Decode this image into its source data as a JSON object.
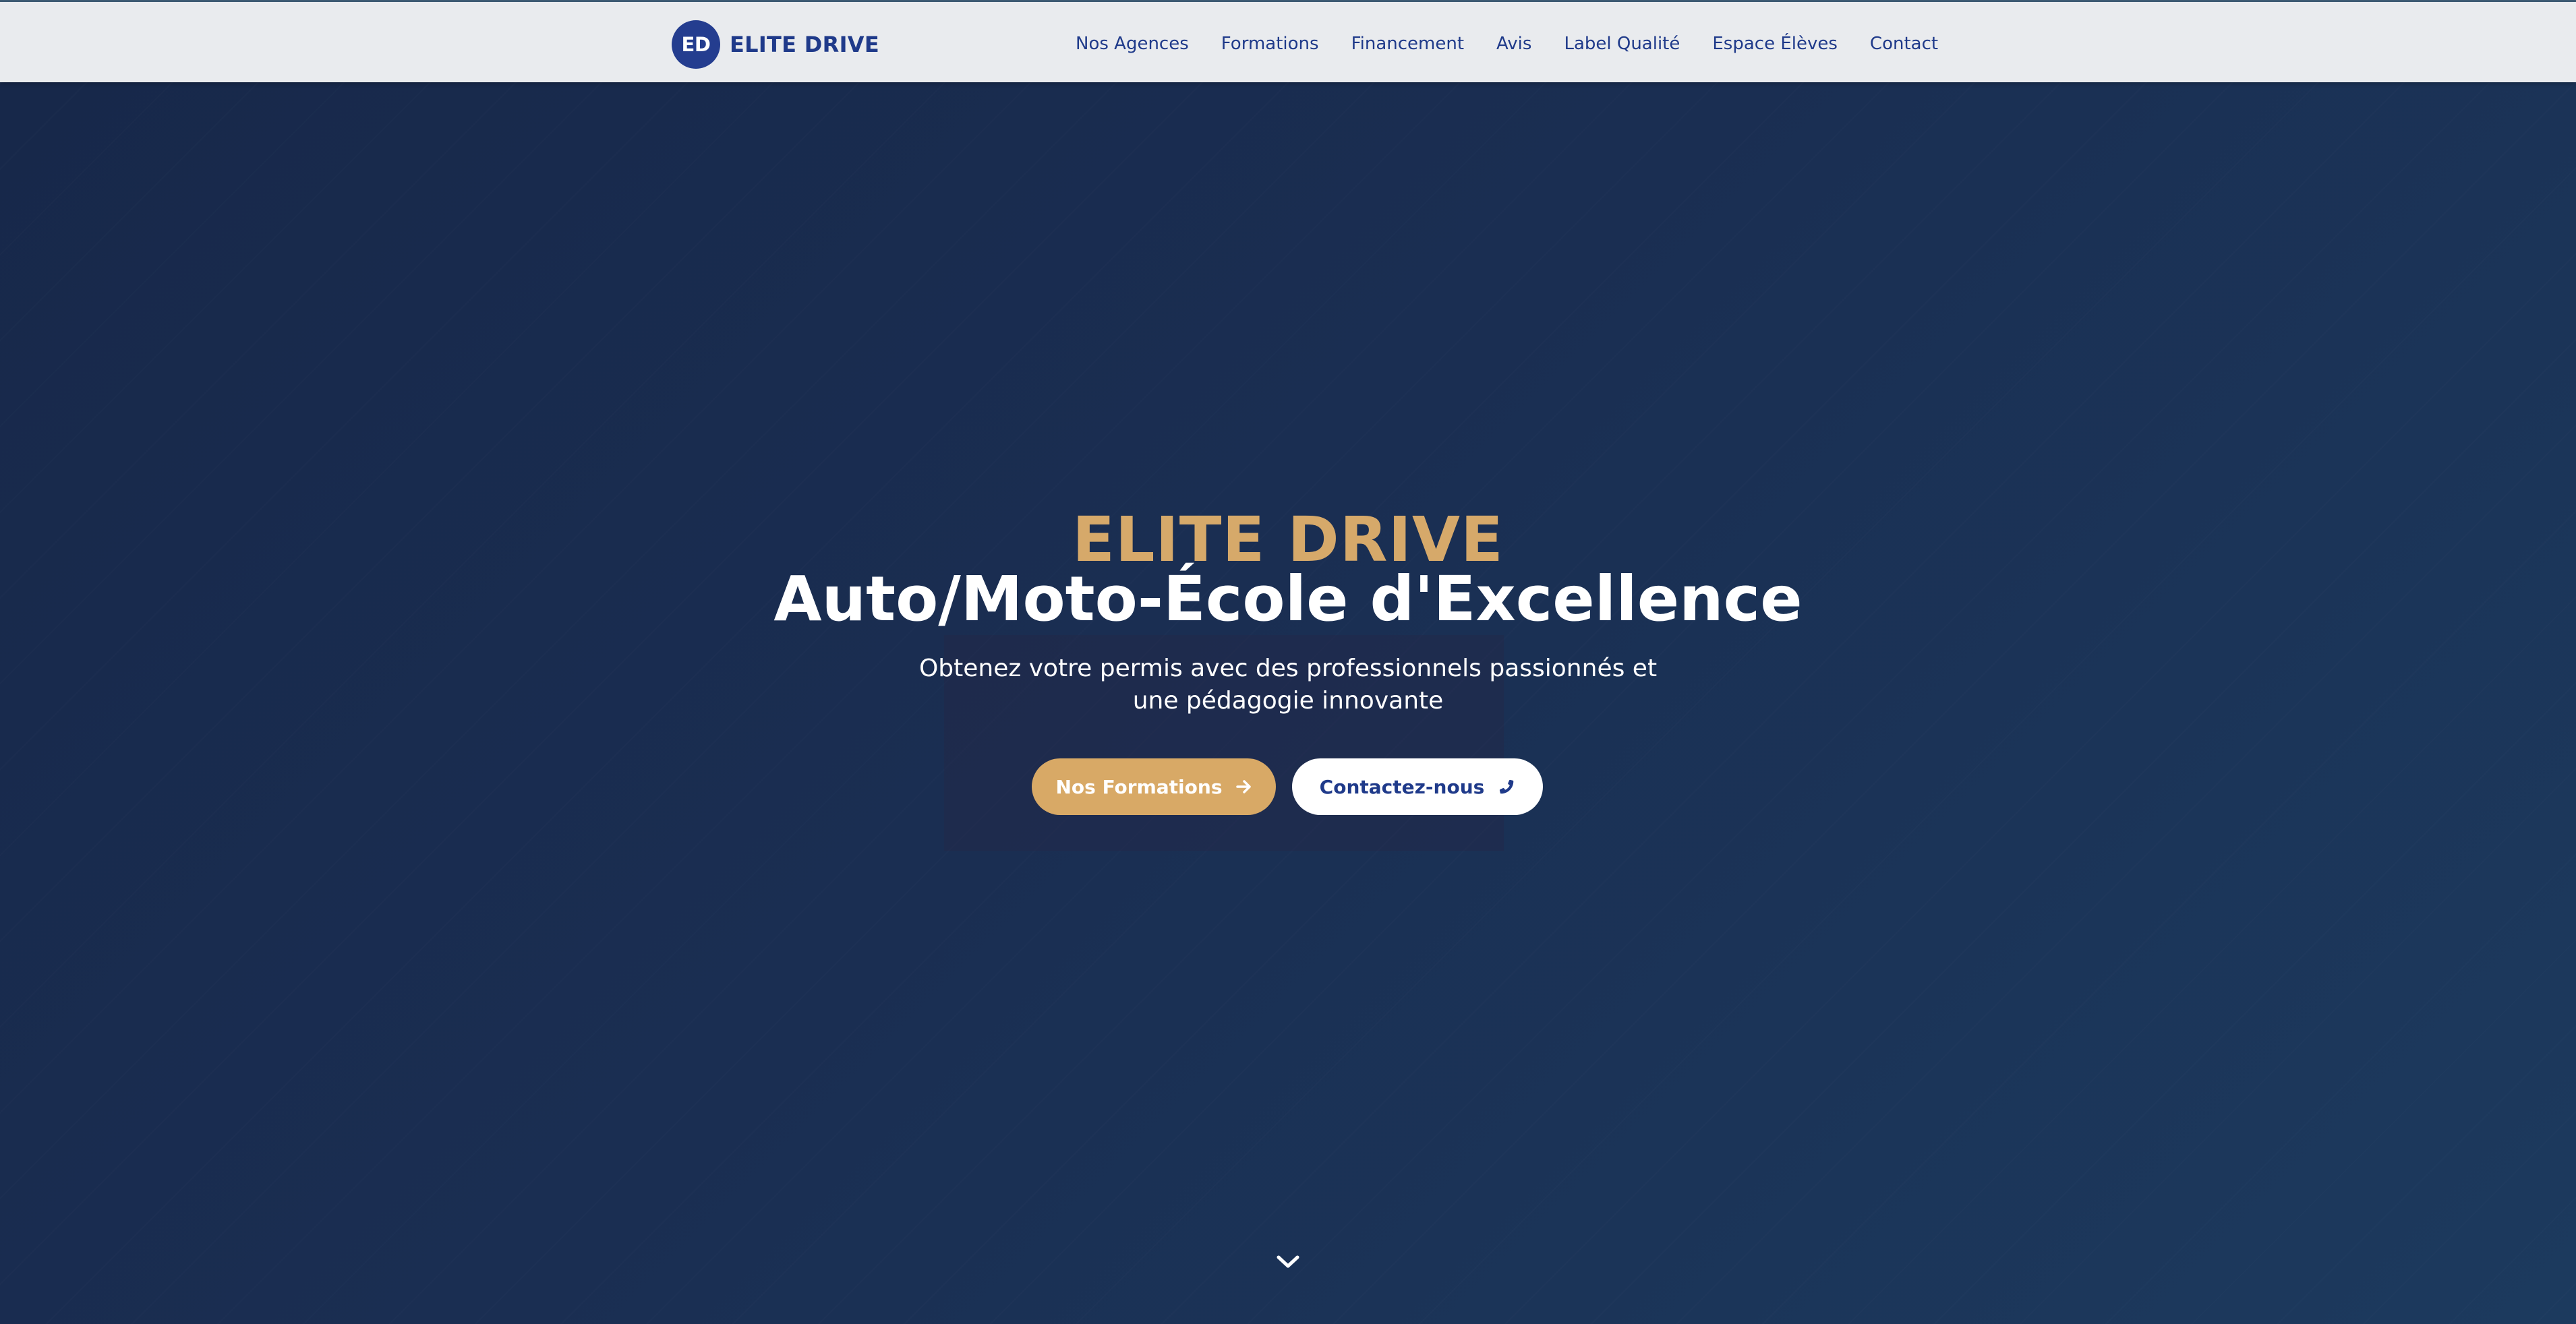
{
  "header": {
    "logo_badge": "ED",
    "logo_text": "ELITE DRIVE",
    "nav": [
      {
        "label": "Nos Agences"
      },
      {
        "label": "Formations"
      },
      {
        "label": "Financement"
      },
      {
        "label": "Avis"
      },
      {
        "label": "Label Qualité"
      },
      {
        "label": "Espace Élèves"
      },
      {
        "label": "Contact"
      }
    ]
  },
  "hero": {
    "brand": "ELITE DRIVE",
    "title": "Auto/Moto-École d'Excellence",
    "subtitle": "Obtenez votre permis avec des professionnels passionnés et une pédagogie innovante",
    "primary_button": {
      "label": "Nos Formations",
      "icon": "arrow-right-icon"
    },
    "secondary_button": {
      "label": "Contactez-nous",
      "icon": "phone-icon"
    },
    "scroll_icon": "chevron-down-icon"
  },
  "colors": {
    "header_bg": "#e9ebee",
    "brand_blue": "#1f3a8a",
    "logo_badge": "#243d8f",
    "hero_bg": "#1a2f52",
    "gold": "#d6a96a",
    "button_gold": "#d8a966",
    "white": "#ffffff"
  }
}
